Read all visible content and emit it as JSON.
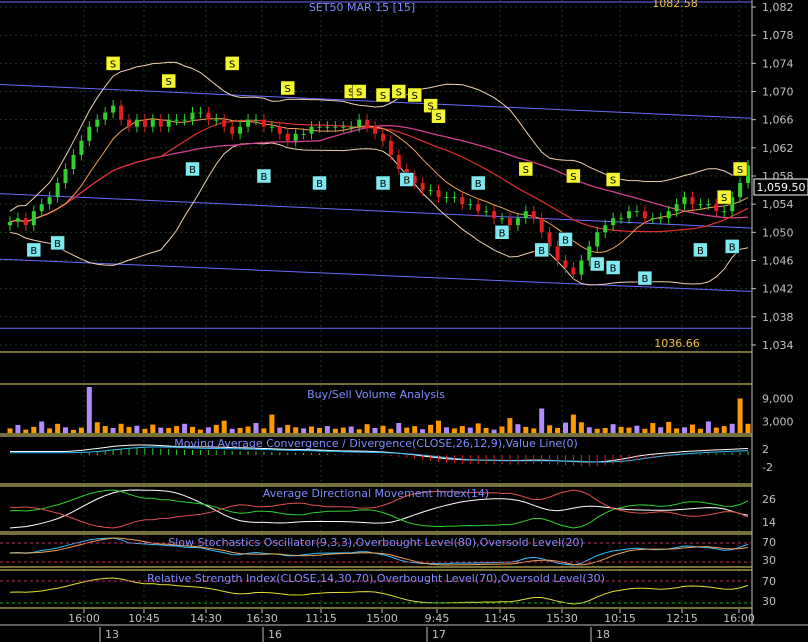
{
  "chart_data": {
    "type": "line",
    "title": "SET50 MAR 15   [15]",
    "price": {
      "y_ticks": [
        "1,082",
        "1,078",
        "1,074",
        "1,070",
        "1,066",
        "1,062",
        "1,058",
        "1,054",
        "1,050",
        "1,046",
        "1,042",
        "1,038",
        "1,034"
      ],
      "ylim": [
        1033,
        1083
      ],
      "last_value": "1,059.50",
      "channel_high_label": "1082.58",
      "channel_low_label": "1036.66",
      "close": [
        1051.5,
        1052,
        1051,
        1053,
        1054,
        1055,
        1057,
        1059,
        1061,
        1063,
        1065,
        1066,
        1067,
        1068,
        1066,
        1065,
        1066,
        1065,
        1066,
        1065,
        1066,
        1066,
        1066,
        1067,
        1067,
        1066,
        1066,
        1065,
        1064,
        1065,
        1066,
        1066,
        1065,
        1065,
        1064,
        1063,
        1064,
        1064,
        1065,
        1065,
        1065,
        1065,
        1065,
        1065,
        1066,
        1065,
        1064,
        1063,
        1061,
        1059,
        1058,
        1057,
        1056,
        1056,
        1055,
        1055,
        1055,
        1054,
        1054,
        1053,
        1053,
        1052,
        1052,
        1051,
        1052,
        1053,
        1052,
        1050,
        1048,
        1046,
        1045,
        1044,
        1046,
        1048,
        1050,
        1051,
        1052,
        1052,
        1053,
        1053,
        1052,
        1052,
        1052,
        1053,
        1054,
        1055,
        1054,
        1054,
        1054,
        1053,
        1053,
        1055,
        1057,
        1059.5
      ],
      "buy_signals": [
        {
          "label": "B",
          "value": 1047.5
        },
        {
          "label": "B",
          "value": 1048.5
        },
        {
          "label": "B",
          "value": 1059
        },
        {
          "label": "B",
          "value": 1058
        },
        {
          "label": "B",
          "value": 1057
        },
        {
          "label": "B",
          "value": 1057
        },
        {
          "label": "B",
          "value": 1057.5
        },
        {
          "label": "B",
          "value": 1057
        },
        {
          "label": "B",
          "value": 1050
        },
        {
          "label": "B",
          "value": 1047.5
        },
        {
          "label": "B",
          "value": 1049
        },
        {
          "label": "B",
          "value": 1045.5
        },
        {
          "label": "B",
          "value": 1045
        },
        {
          "label": "B",
          "value": 1043.5
        },
        {
          "label": "B",
          "value": 1047.5
        },
        {
          "label": "B",
          "value": 1048
        }
      ],
      "sell_signals": [
        {
          "label": "S",
          "value": 1074
        },
        {
          "label": "S",
          "value": 1071.5
        },
        {
          "label": "S",
          "value": 1074
        },
        {
          "label": "S",
          "value": 1070.5
        },
        {
          "label": "S",
          "value": 1070
        },
        {
          "label": "S",
          "value": 1070
        },
        {
          "label": "S",
          "value": 1069.5
        },
        {
          "label": "S",
          "value": 1070
        },
        {
          "label": "S",
          "value": 1069.5
        },
        {
          "label": "S",
          "value": 1068
        },
        {
          "label": "S",
          "value": 1066.5
        },
        {
          "label": "S",
          "value": 1059
        },
        {
          "label": "S",
          "value": 1058
        },
        {
          "label": "S",
          "value": 1057.5
        },
        {
          "label": "S",
          "value": 1055
        },
        {
          "label": "S",
          "value": 1059
        }
      ]
    },
    "volume": {
      "title": "Buy/Sell Volume Analysis",
      "y_ticks": [
        "9,000",
        "3,000"
      ],
      "ylim": [
        0,
        12000
      ],
      "values": [
        1200,
        2100,
        900,
        1600,
        3000,
        1200,
        2400,
        1500,
        800,
        1400,
        12000,
        2800,
        1800,
        1300,
        2400,
        1600,
        1900,
        1100,
        2200,
        1400,
        1300,
        1800,
        2400,
        1600,
        900,
        1500,
        2100,
        3200,
        1100,
        1300,
        1700,
        2600,
        1200,
        4800,
        1400,
        2100,
        1500,
        1200,
        1700,
        1300,
        1800,
        1100,
        1400,
        1700,
        1000,
        2300,
        1300,
        1900,
        1100,
        2600,
        1400,
        1800,
        1000,
        2100,
        3200,
        1500,
        1200,
        1800,
        1400,
        2500,
        1300,
        900,
        1700,
        3900,
        2300,
        1600,
        1200,
        6400,
        2000,
        1300,
        2700,
        4800,
        2800,
        1500,
        1100,
        1300,
        2300,
        1600,
        1400,
        1900,
        1100,
        2600,
        1500,
        2900,
        1200,
        1500,
        2200,
        1100,
        3000,
        1400,
        1800,
        2400,
        9000,
        2400
      ]
    },
    "macd": {
      "title": "Moving Average Convergence / Divergence(CLOSE,26,12,9),Value Line(0)",
      "y_ticks": [
        "2",
        "-2"
      ],
      "ylim": [
        -3,
        3
      ]
    },
    "adx": {
      "title": "Average Directional Movement Index(14)",
      "y_ticks": [
        "26",
        "14"
      ],
      "ylim": [
        8,
        34
      ]
    },
    "stochastic": {
      "title": "Slow Stochastics Oscillator(9,3,3),Overbought Level(80),Oversold Level(20)",
      "y_ticks": [
        "70",
        "30"
      ],
      "ylim": [
        0,
        100
      ]
    },
    "rsi": {
      "title": "Relative Strength Index(CLOSE,14,30,70),Overbought Level(70),Oversold Level(30)",
      "y_ticks": [
        "70",
        "30"
      ],
      "ylim": [
        15,
        85
      ]
    },
    "x_ticks": [
      "16:00",
      "10:45",
      "14:30",
      "16:30",
      "11:15",
      "15:00",
      "9:45",
      "11:45",
      "15:30",
      "10:15",
      "12:15",
      "16:00"
    ],
    "dates": [
      "13",
      "16",
      "17",
      "18"
    ],
    "grid": true,
    "colors": {
      "background": "#000000",
      "grid": "#1e3a1e",
      "axis_label": "#c0c0c0",
      "title": "#7f8cff",
      "candle_up": "#2fd02f",
      "candle_down": "#e02020",
      "channel": "#6b6bff",
      "buy_bg": "#7fe8f0",
      "sell_bg": "#f5f532",
      "panel_border": "#e8e070",
      "volume_up": "#ff9900",
      "volume_down": "#b08cff"
    }
  }
}
